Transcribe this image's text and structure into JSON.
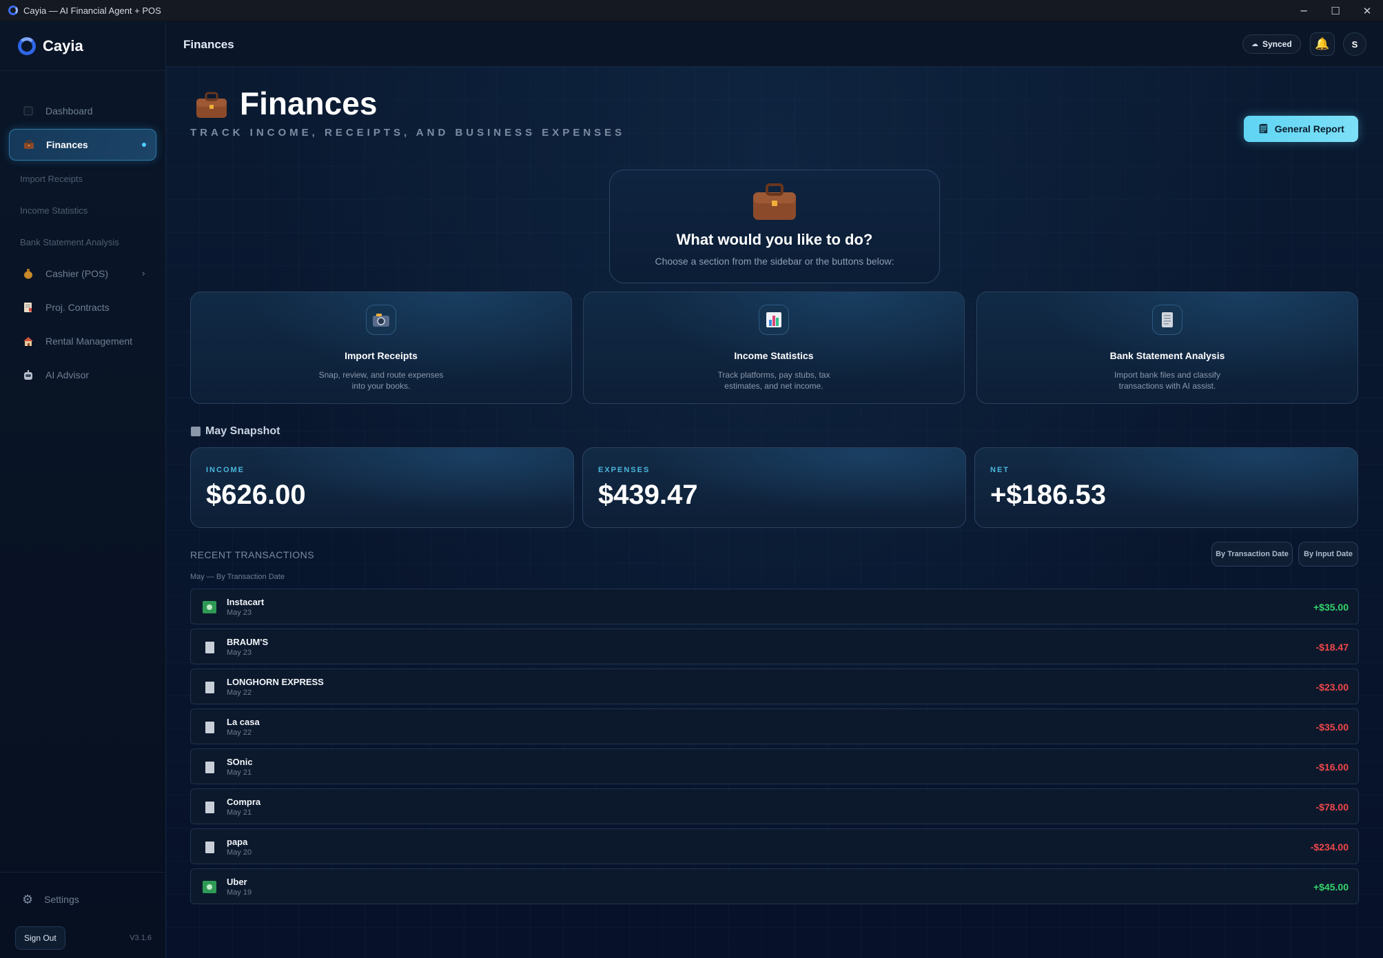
{
  "window": {
    "title": "Cayia — AI Financial Agent + POS",
    "controls": [
      "─",
      "☐",
      "✕"
    ]
  },
  "sidebar": {
    "brand": "Cayia",
    "items": [
      {
        "label": "Dashboard",
        "icon": "dashboard-icon"
      },
      {
        "label": "Finances",
        "icon": "briefcase-icon",
        "active": true
      }
    ],
    "subitems": [
      "Import Receipts",
      "Income Statistics",
      "Bank Statement Analysis"
    ],
    "more_items": [
      {
        "label": "Cashier (POS)",
        "icon": "money-bag-icon",
        "chevron": "›"
      },
      {
        "label": "Proj. Contracts",
        "icon": "memo-icon"
      },
      {
        "label": "Rental Management",
        "icon": "house-icon"
      },
      {
        "label": "AI Advisor",
        "icon": "robot-icon"
      }
    ],
    "settings": "Settings",
    "sign_out": "Sign Out",
    "version": "V3.1.6"
  },
  "topbar": {
    "title": "Finances",
    "synced": "Synced",
    "avatar_initial": "S"
  },
  "hero": {
    "title": "Finances",
    "subtitle": "TRACK INCOME, RECEIPTS, AND BUSINESS EXPENSES",
    "report_button": "General Report"
  },
  "prompt_card": {
    "title": "What would you like to do?",
    "subtitle": "Choose a section from the sidebar or the buttons below:"
  },
  "actions": [
    {
      "title": "Import Receipts",
      "desc": "Snap, review, and route expenses into your books.",
      "icon": "camera-icon"
    },
    {
      "title": "Income Statistics",
      "desc": "Track platforms, pay stubs, tax estimates, and net income.",
      "icon": "bar-chart-icon"
    },
    {
      "title": "Bank Statement Analysis",
      "desc": "Import bank files and classify transactions with AI assist.",
      "icon": "document-icon"
    }
  ],
  "snapshot": {
    "title": "May Snapshot",
    "income_label": "INCOME",
    "income": "$626.00",
    "expenses_label": "EXPENSES",
    "expenses": "$439.47",
    "net_label": "NET",
    "net": "+$186.53"
  },
  "transactions": {
    "heading": "RECENT TRANSACTIONS",
    "sort_by_transaction": "By Transaction Date",
    "sort_by_input": "By Input Date",
    "subheading": "May — By Transaction Date",
    "rows": [
      {
        "name": "Instacart",
        "date": "May 23",
        "amount": "+$35.00",
        "type": "income"
      },
      {
        "name": "BRAUM'S",
        "date": "May 23",
        "amount": "-$18.47",
        "type": "expense"
      },
      {
        "name": "LONGHORN EXPRESS",
        "date": "May 22",
        "amount": "-$23.00",
        "type": "expense"
      },
      {
        "name": "La casa",
        "date": "May 22",
        "amount": "-$35.00",
        "type": "expense"
      },
      {
        "name": "SOnic",
        "date": "May 21",
        "amount": "-$16.00",
        "type": "expense"
      },
      {
        "name": "Compra",
        "date": "May 21",
        "amount": "-$78.00",
        "type": "expense"
      },
      {
        "name": "papa",
        "date": "May 20",
        "amount": "-$234.00",
        "type": "expense"
      },
      {
        "name": "Uber",
        "date": "May 19",
        "amount": "+$45.00",
        "type": "income"
      }
    ]
  },
  "colors": {
    "accent": "#5fd4f3",
    "positive": "#34d46a",
    "negative": "#f0474a",
    "label": "#4ab8de"
  }
}
